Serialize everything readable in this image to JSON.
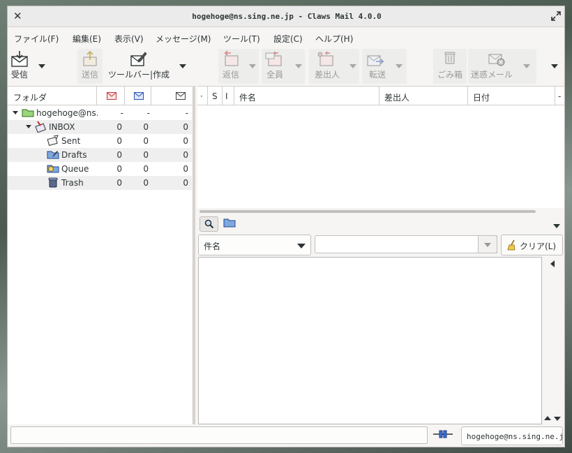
{
  "window": {
    "title": "hogehoge@ns.sing.ne.jp - Claws Mail 4.0.0"
  },
  "menu": [
    "ファイル(F)",
    "編集(E)",
    "表示(V)",
    "メッセージ(M)",
    "ツール(T)",
    "設定(C)",
    "ヘルプ(H)"
  ],
  "toolbar": {
    "receive": "受信",
    "send": "送信",
    "compose": "ツールバー|作成",
    "reply": "返信",
    "reply_all": "全員",
    "reply_sender": "差出人",
    "forward": "転送",
    "trash": "ごみ箱",
    "spam": "迷惑メール"
  },
  "folder_pane": {
    "header": "フォルダ",
    "rows": [
      {
        "name": "hogehoge@ns.s",
        "new": "-",
        "unread": "-",
        "total": "-"
      },
      {
        "name": "INBOX",
        "new": "0",
        "unread": "0",
        "total": "0"
      },
      {
        "name": "Sent",
        "new": "0",
        "unread": "0",
        "total": "0"
      },
      {
        "name": "Drafts",
        "new": "0",
        "unread": "0",
        "total": "0"
      },
      {
        "name": "Queue",
        "new": "0",
        "unread": "0",
        "total": "0"
      },
      {
        "name": "Trash",
        "new": "0",
        "unread": "0",
        "total": "0"
      }
    ]
  },
  "message_list": {
    "columns": {
      "mark": "·",
      "status": "S",
      "attach": "I",
      "subject": "件名",
      "from": "差出人",
      "date": "日付",
      "more": "-"
    }
  },
  "quick_search": {
    "type": "件名",
    "value": "",
    "clear": "クリア(L)"
  },
  "status": {
    "message": "",
    "account": "hogehoge@ns.sing.ne.jp"
  }
}
